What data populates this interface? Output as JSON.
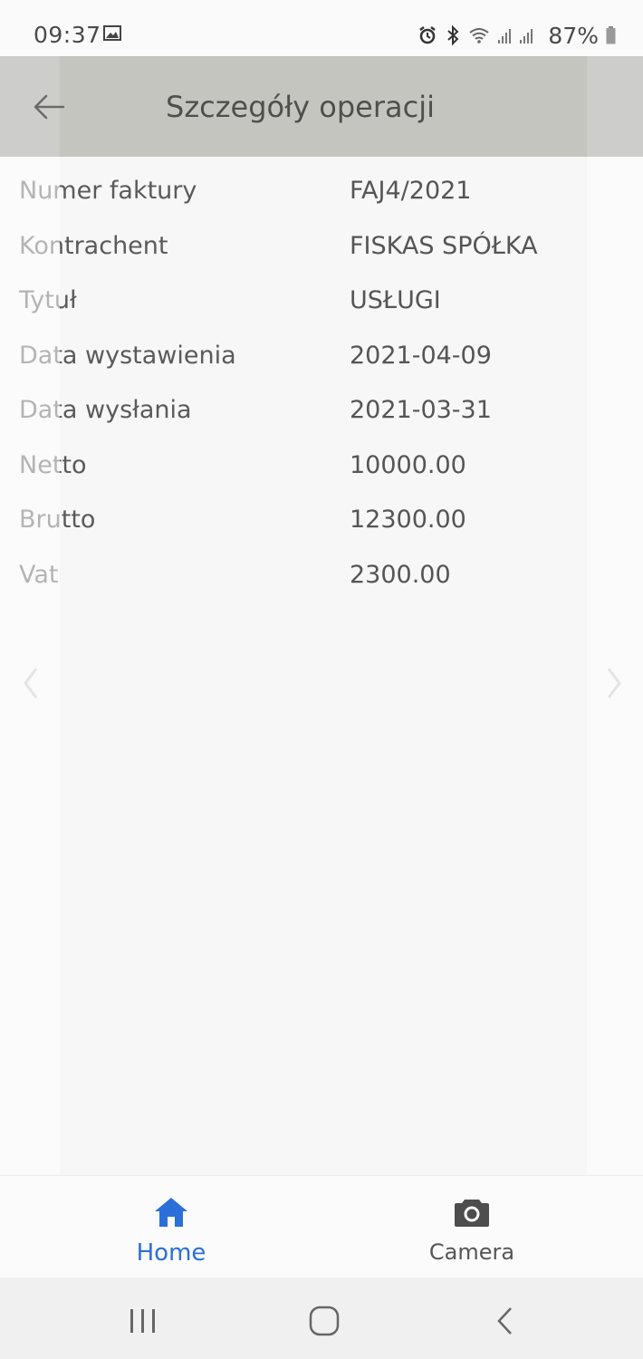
{
  "status_bar": {
    "time": "09:37",
    "battery": "87%",
    "icons": [
      "gallery-icon",
      "alarm-icon",
      "bluetooth-icon",
      "wifi-icon",
      "signal-icon",
      "battery-icon"
    ]
  },
  "app_bar": {
    "title": "Szczegóły operacji",
    "back_icon": "arrow-left-icon"
  },
  "details": [
    {
      "label": "Numer faktury",
      "value": "FAJ4/2021"
    },
    {
      "label": "Kontrachent",
      "value": "FISKAS SPÓŁKA"
    },
    {
      "label": "Tytuł",
      "value": "USŁUGI"
    },
    {
      "label": "Data wystawienia",
      "value": "2021-04-09"
    },
    {
      "label": "Data wysłania",
      "value": "2021-03-31"
    },
    {
      "label": "Netto",
      "value": "10000.00"
    },
    {
      "label": "Brutto",
      "value": "12300.00"
    },
    {
      "label": "Vat",
      "value": "2300.00"
    }
  ],
  "bottom_nav": {
    "items": [
      {
        "label": "Home",
        "icon": "home-icon",
        "active": true
      },
      {
        "label": "Camera",
        "icon": "camera-icon",
        "active": false
      }
    ]
  },
  "colors": {
    "accent": "#2c6fd8",
    "app_bar": "#c5c5c0",
    "text": "#555555"
  }
}
